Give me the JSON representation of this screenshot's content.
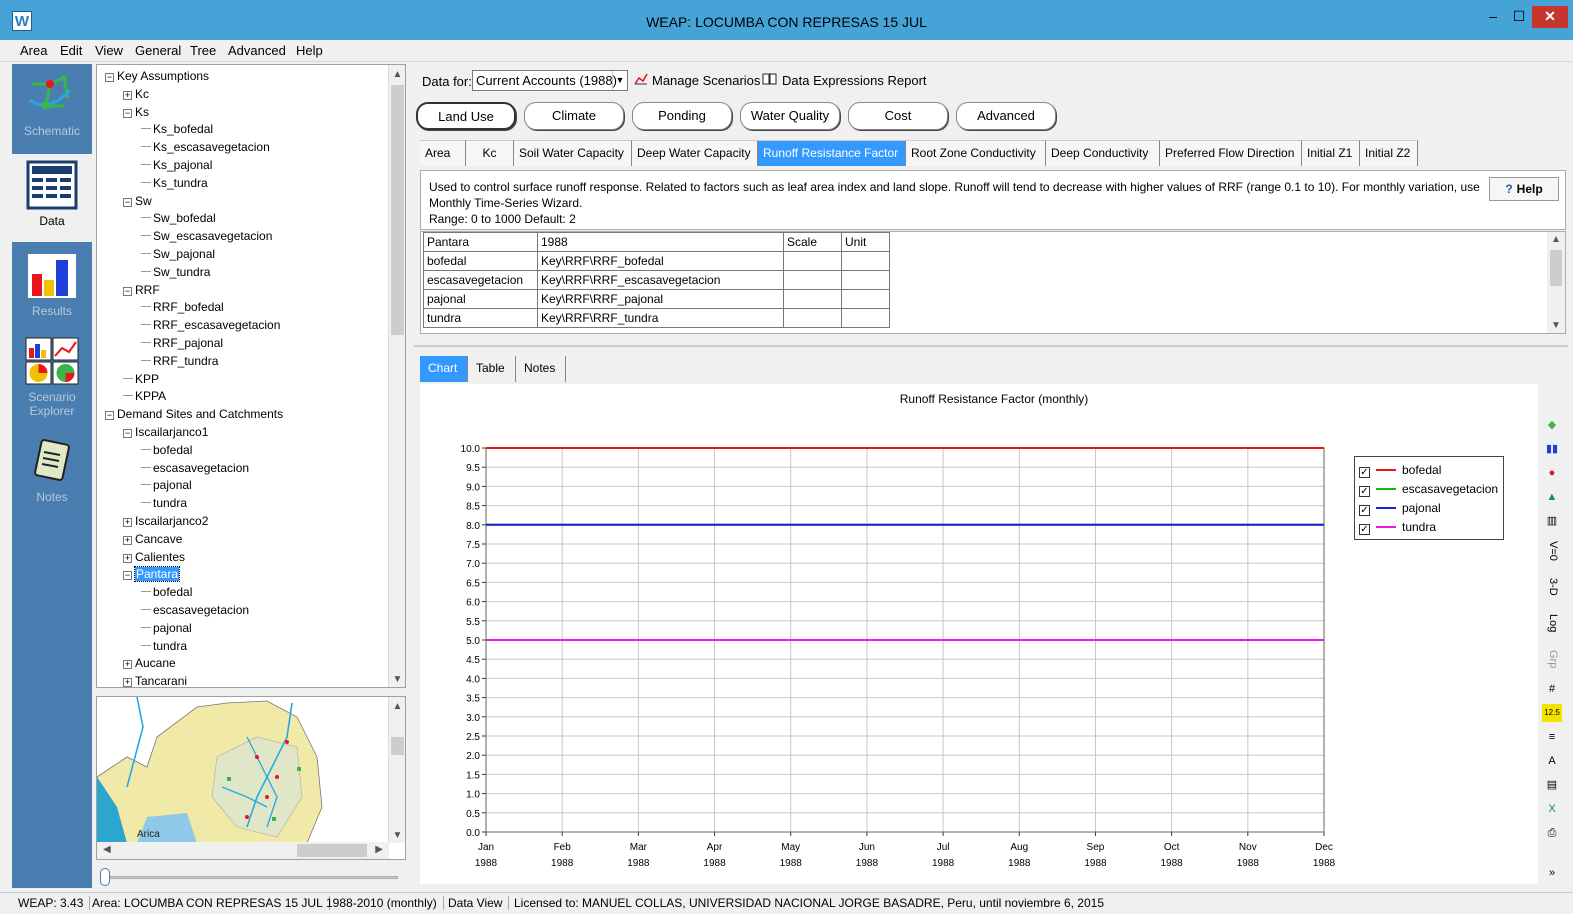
{
  "window": {
    "title": "WEAP: LOCUMBA CON REPRESAS 15 JUL",
    "app_icon": "W",
    "minimize": "–",
    "maximize": "☐",
    "close": "✕"
  },
  "menu": [
    "Area",
    "Edit",
    "View",
    "General",
    "Tree",
    "Advanced",
    "Help"
  ],
  "views": [
    {
      "label": "Schematic",
      "icon": "schematic-icon"
    },
    {
      "label": "Data",
      "icon": "data-icon",
      "active": true
    },
    {
      "label": "Results",
      "icon": "results-icon"
    },
    {
      "label": "Scenario Explorer",
      "icon": "scenario-explorer-icon"
    },
    {
      "label": "Notes",
      "icon": "notes-icon"
    }
  ],
  "tree": [
    {
      "label": "Key Assumptions",
      "exp": "−"
    },
    {
      "label": "Kc",
      "exp": "+"
    },
    {
      "label": "Ks",
      "exp": "−"
    },
    {
      "label": "Ks_bofedal"
    },
    {
      "label": "Ks_escasavegetacion"
    },
    {
      "label": "Ks_pajonal"
    },
    {
      "label": "Ks_tundra"
    },
    {
      "label": "Sw",
      "exp": "−"
    },
    {
      "label": "Sw_bofedal"
    },
    {
      "label": "Sw_escasavegetacion"
    },
    {
      "label": "Sw_pajonal"
    },
    {
      "label": "Sw_tundra"
    },
    {
      "label": "RRF",
      "exp": "−"
    },
    {
      "label": "RRF_bofedal"
    },
    {
      "label": "RRF_escasavegetacion"
    },
    {
      "label": "RRF_pajonal"
    },
    {
      "label": "RRF_tundra"
    },
    {
      "label": "KPP"
    },
    {
      "label": "KPPA"
    },
    {
      "label": "Demand Sites and Catchments",
      "exp": "−"
    },
    {
      "label": "Iscailarjanco1",
      "exp": "−"
    },
    {
      "label": "bofedal"
    },
    {
      "label": "escasavegetacion"
    },
    {
      "label": "pajonal"
    },
    {
      "label": "tundra"
    },
    {
      "label": "Iscailarjanco2",
      "exp": "+"
    },
    {
      "label": "Cancave",
      "exp": "+"
    },
    {
      "label": "Calientes",
      "exp": "+"
    },
    {
      "label": "Pantara",
      "exp": "−",
      "selected": true
    },
    {
      "label": "bofedal"
    },
    {
      "label": "escasavegetacion"
    },
    {
      "label": "pajonal"
    },
    {
      "label": "tundra"
    },
    {
      "label": "Aucane",
      "exp": "+"
    },
    {
      "label": "Tancarani",
      "exp": "+"
    }
  ],
  "minimap": {
    "place_label": "Arica"
  },
  "data_header": {
    "data_for_label": "Data for:",
    "scenario": "Current Accounts (1988)",
    "manage_scenarios": "Manage Scenarios",
    "expressions_report": "Data Expressions Report"
  },
  "category_tabs": [
    "Land Use",
    "Climate",
    "Ponding",
    "Water Quality",
    "Cost",
    "Advanced"
  ],
  "sub_tabs": [
    "Area",
    "Kc",
    "Soil Water Capacity",
    "Deep Water Capacity",
    "Runoff Resistance Factor",
    "Root Zone Conductivity",
    "Deep Conductivity",
    "Preferred Flow Direction",
    "Initial Z1",
    "Initial Z2"
  ],
  "description": {
    "text": "Used to control surface runoff response.  Related to factors such as leaf area index and land slope.  Runoff will tend to decrease with higher values of RRF (range 0.1 to 10).  For monthly variation, use Monthly Time-Series Wizard.",
    "range": "Range: 0 to 1000   Default: 2",
    "help": "Help"
  },
  "grid": {
    "headers": [
      "Pantara",
      "1988",
      "Scale",
      "Unit"
    ],
    "rows": [
      [
        "bofedal",
        "Key\\RRF\\RRF_bofedal"
      ],
      [
        "escasavegetacion",
        "Key\\RRF\\RRF_escasavegetacion"
      ],
      [
        "pajonal",
        "Key\\RRF\\RRF_pajonal"
      ],
      [
        "tundra",
        "Key\\RRF\\RRF_tundra"
      ]
    ]
  },
  "result_tabs": [
    "Chart",
    "Table",
    "Notes"
  ],
  "chart_data": {
    "type": "line",
    "title": "Runoff Resistance Factor (monthly)",
    "x": [
      "Jan 1988",
      "Feb 1988",
      "Mar 1988",
      "Apr 1988",
      "May 1988",
      "Jun 1988",
      "Jul 1988",
      "Aug 1988",
      "Sep 1988",
      "Oct 1988",
      "Nov 1988",
      "Dec 1988"
    ],
    "x_months": [
      "Jan",
      "Feb",
      "Mar",
      "Apr",
      "May",
      "Jun",
      "Jul",
      "Aug",
      "Sep",
      "Oct",
      "Nov",
      "Dec"
    ],
    "x_year": "1988",
    "ylim": [
      0,
      10
    ],
    "yticks": [
      "0.0",
      "0.5",
      "1.0",
      "1.5",
      "2.0",
      "2.5",
      "3.0",
      "3.5",
      "4.0",
      "4.5",
      "5.0",
      "5.5",
      "6.0",
      "6.5",
      "7.0",
      "7.5",
      "8.0",
      "8.5",
      "9.0",
      "9.5",
      "10.0"
    ],
    "grid": true,
    "legend_position": "right",
    "series": [
      {
        "name": "bofedal",
        "color": "#e8161c",
        "values": [
          10,
          10,
          10,
          10,
          10,
          10,
          10,
          10,
          10,
          10,
          10,
          10
        ]
      },
      {
        "name": "escasavegetacion",
        "color": "#18b418",
        "values": [
          8,
          8,
          8,
          8,
          8,
          8,
          8,
          8,
          8,
          8,
          8,
          8
        ]
      },
      {
        "name": "pajonal",
        "color": "#1f1fd8",
        "values": [
          8,
          8,
          8,
          8,
          8,
          8,
          8,
          8,
          8,
          8,
          8,
          8
        ]
      },
      {
        "name": "tundra",
        "color": "#e81ce8",
        "values": [
          5,
          5,
          5,
          5,
          5,
          5,
          5,
          5,
          5,
          5,
          5,
          5
        ]
      }
    ]
  },
  "chart_tools": [
    "V=0",
    "3-D",
    "Log",
    "Grp"
  ],
  "status": {
    "version": "WEAP: 3.43",
    "area": "Area: LOCUMBA CON REPRESAS 15 JUL",
    "period": "1988-2010 (monthly)",
    "view": "Data View",
    "license": "Licensed to: MANUEL COLLAS, UNIVERSIDAD NACIONAL JORGE BASADRE, Peru, until noviembre 6, 2015"
  }
}
